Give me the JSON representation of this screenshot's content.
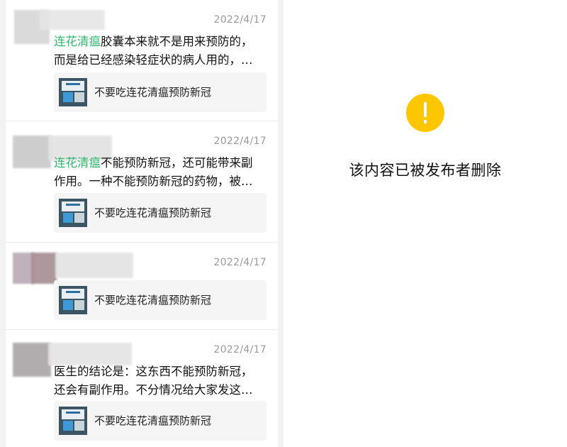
{
  "posts": [
    {
      "date": "2022/4/17",
      "line1_highlight": "连花清瘟",
      "line1_rest": "胶囊本来就不是用来预防的，",
      "line2": "而是给已经感染轻症状的病人用的，…",
      "card_title": "不要吃连花清瘟预防新冠"
    },
    {
      "date": "2022/4/17",
      "line1_highlight": "连花清瘟",
      "line1_rest": "不能预防新冠，还可能带来副",
      "line2": "作用。一种不能预防新冠的药物，被…",
      "card_title": "不要吃连花清瘟预防新冠"
    },
    {
      "date": "2022/4/17",
      "card_title": "不要吃连花清瘟预防新冠"
    },
    {
      "date": "2022/4/17",
      "line1": "医生的结论是：这东西不能预防新冠，",
      "line2": "还会有副作用。不分情况给大家发这…",
      "card_title": "不要吃连花清瘟预防新冠"
    }
  ],
  "deleted_panel": {
    "icon": "warning-icon",
    "message": "该内容已被发布者删除"
  },
  "colors": {
    "highlight": "#2fb86e",
    "warning": "#fcc600"
  }
}
